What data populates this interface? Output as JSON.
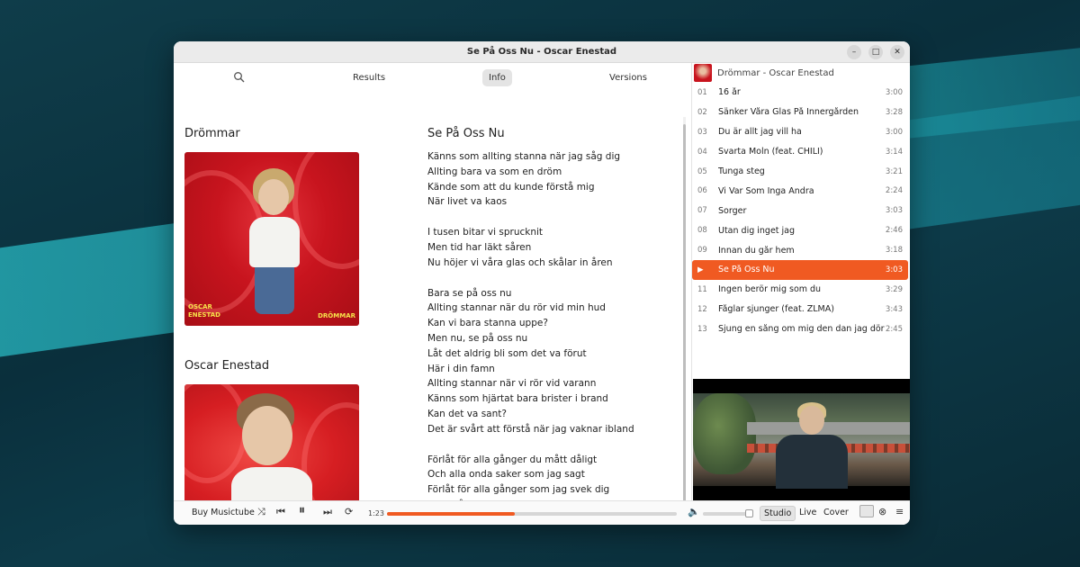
{
  "window": {
    "title": "Se På Oss Nu - Oscar Enestad"
  },
  "tabs": [
    {
      "label": "Results"
    },
    {
      "label": "Info"
    },
    {
      "label": "Versions"
    }
  ],
  "info": {
    "album_heading": "Drömmar",
    "artist_heading": "Oscar Enestad",
    "cover_text_left": "OSCAR ENESTAD",
    "cover_text_right": "DRÖMMAR",
    "lyrics_title": "Se På Oss Nu",
    "lyrics": [
      [
        "Känns som allting stanna när jag såg dig",
        "Allting bara va som en dröm",
        "Kände som att du kunde förstå mig",
        "När livet va kaos"
      ],
      [
        "I tusen bitar vi sprucknit",
        "Men tid har läkt såren",
        "Nu höjer vi våra glas och skålar in åren"
      ],
      [
        "Bara se på oss nu",
        "Allting stannar när du rör vid min hud",
        "Kan vi bara stanna uppe?",
        "Men nu, se på oss nu",
        "Låt det aldrig bli som det va förut",
        "Här i din famn",
        "Allting stannar när vi rör vid varann",
        "Känns som hjärtat bara brister i brand",
        "Kan det va sant?",
        "Det är svårt att förstå när jag vaknar ibland"
      ],
      [
        "Förlåt för alla gånger du mått dåligt",
        "Och alla onda saker som jag sagt",
        "Förlåt för alla gånger som jag svek dig",
        "Och måla världen svart"
      ]
    ]
  },
  "sidebar": {
    "header": "Drömmar - Oscar Enestad",
    "tracks": [
      {
        "num": "01",
        "name": "16 år",
        "dur": "3:00"
      },
      {
        "num": "02",
        "name": "Sänker Våra Glas På Innergården",
        "dur": "3:28"
      },
      {
        "num": "03",
        "name": "Du är allt jag vill ha",
        "dur": "3:00"
      },
      {
        "num": "04",
        "name": "Svarta Moln (feat. CHILI)",
        "dur": "3:14"
      },
      {
        "num": "05",
        "name": "Tunga steg",
        "dur": "3:21"
      },
      {
        "num": "06",
        "name": "Vi Var Som Inga Andra",
        "dur": "2:24"
      },
      {
        "num": "07",
        "name": "Sorger",
        "dur": "3:03"
      },
      {
        "num": "08",
        "name": "Utan dig inget jag",
        "dur": "2:46"
      },
      {
        "num": "09",
        "name": "Innan du går hem",
        "dur": "3:18"
      },
      {
        "num": "▶",
        "name": "Se På Oss Nu",
        "dur": "3:03"
      },
      {
        "num": "11",
        "name": "Ingen berör mig som du",
        "dur": "3:29"
      },
      {
        "num": "12",
        "name": "Fåglar sjunger (feat. ZLMA)",
        "dur": "3:43"
      },
      {
        "num": "13",
        "name": "Sjung en sång om mig den dan jag dör",
        "dur": "2:45"
      }
    ],
    "active_index": 9
  },
  "player": {
    "buy_label": "Buy Musictube",
    "elapsed": "1:23",
    "progress": 0.44,
    "volume": 1.0,
    "modes": [
      "Studio",
      "Live",
      "Cover"
    ],
    "active_mode": "Studio"
  },
  "colors": {
    "accent": "#f05a22",
    "cover_red": "#c8141e"
  }
}
